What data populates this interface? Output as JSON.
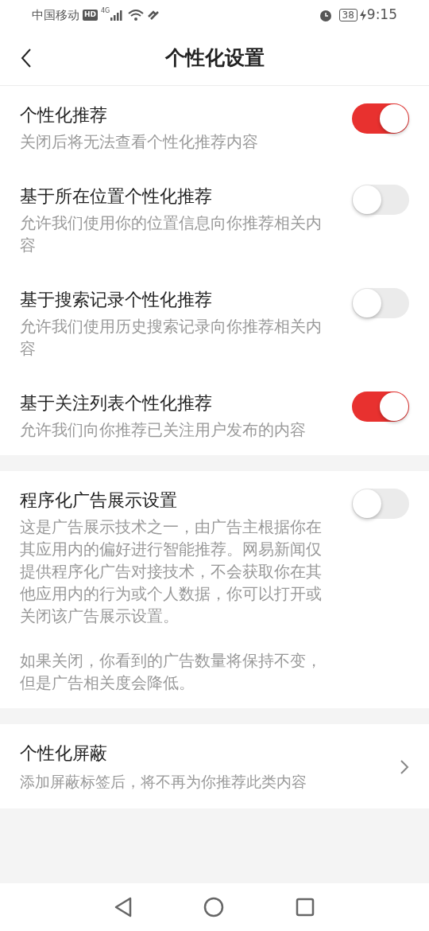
{
  "status_bar": {
    "carrier": "中国移动",
    "hd": "HD",
    "network": "4G",
    "battery": "38",
    "time": "9:15"
  },
  "header": {
    "title": "个性化设置"
  },
  "sections": [
    {
      "items": [
        {
          "title": "个性化推荐",
          "description": "关闭后将无法查看个性化推荐内容",
          "on": true
        },
        {
          "title": "基于所在位置个性化推荐",
          "description": "允许我们使用你的位置信息向你推荐相关内容",
          "on": false
        },
        {
          "title": "基于搜索记录个性化推荐",
          "description": "允许我们使用历史搜索记录向你推荐相关内容",
          "on": false
        },
        {
          "title": "基于关注列表个性化推荐",
          "description": "允许我们向你推荐已关注用户发布的内容",
          "on": true
        }
      ]
    },
    {
      "items": [
        {
          "title": "程序化广告展示设置",
          "description": "这是广告展示技术之一，由广告主根据你在其应用内的偏好进行智能推荐。网易新闻仅提供程序化广告对接技术，不会获取你在其他应用内的行为或个人数据，你可以打开或关闭该广告展示设置。",
          "note": "如果关闭，你看到的广告数量将保持不变，但是广告相关度会降低。",
          "on": false
        }
      ]
    },
    {
      "link": {
        "title": "个性化屏蔽",
        "description": "添加屏蔽标签后，将不再为你推荐此类内容"
      }
    }
  ]
}
